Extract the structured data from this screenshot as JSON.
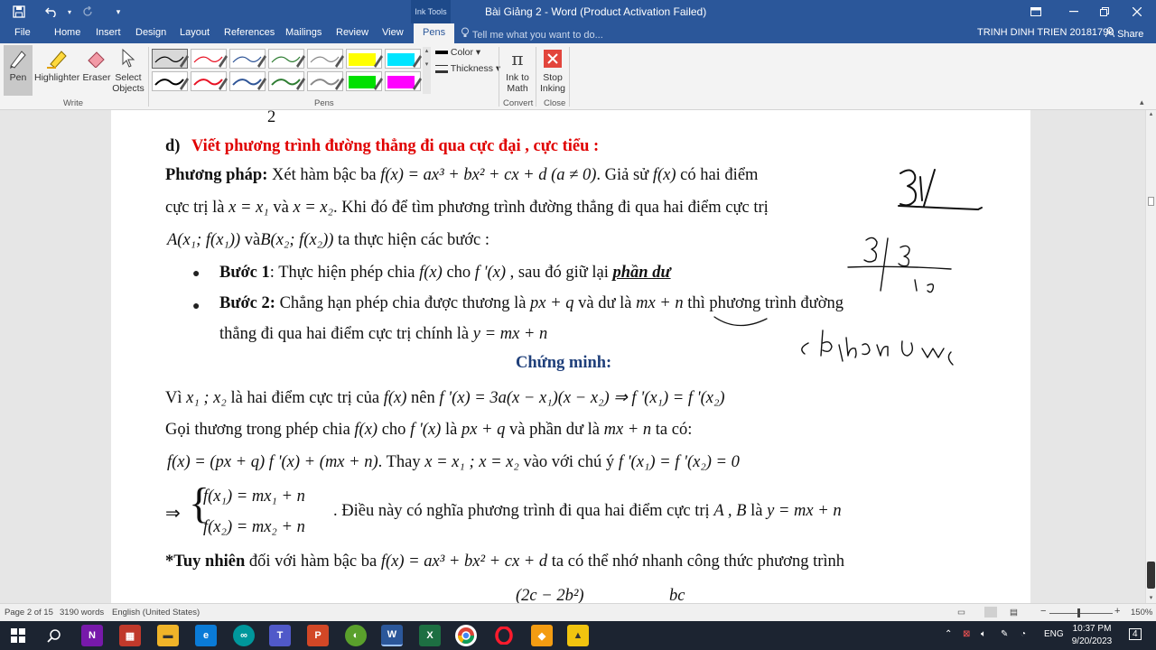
{
  "titlebar": {
    "title": "Bài Giảng 2 - Word (Product Activation Failed)",
    "ink_tools": "Ink Tools",
    "icons": [
      "save-icon",
      "undo-icon",
      "redo-icon",
      "customize-icon",
      "ribbon-display-icon",
      "minimize-icon",
      "restore-icon",
      "close-icon"
    ]
  },
  "tabs": [
    "File",
    "Home",
    "Insert",
    "Design",
    "Layout",
    "References",
    "Mailings",
    "Review",
    "View",
    "Pens"
  ],
  "active_tab": "Pens",
  "tell_me": "Tell me what you want to do...",
  "user": "TRINH DINH TRIEN 20181790",
  "share": "Share",
  "ribbon": {
    "write": {
      "pen": "Pen",
      "highlighter": "Highlighter",
      "eraser": "Eraser",
      "select_objects_1": "Select",
      "select_objects_2": "Objects",
      "label": "Write"
    },
    "pens_label": "Pens",
    "pen_colors": [
      "#000000",
      "#e81123",
      "#2f5597",
      "#2e7d32",
      "#888888",
      "#ffff00",
      "#00e5ff",
      "#000000",
      "#e81123",
      "#2f5597",
      "#2e7d32",
      "#888888",
      "#00e000",
      "#ff00ff"
    ],
    "color": "Color",
    "thickness": "Thickness",
    "convert": {
      "ink_to_math_1": "Ink to",
      "ink_to_math_2": "Math",
      "label": "Convert"
    },
    "close": {
      "stop_inking_1": "Stop",
      "stop_inking_2": "Inking",
      "label": "Close"
    }
  },
  "document": {
    "top_fragment": "2",
    "heading_d": "d)",
    "heading": "Viết phương trình đường thẳng đi qua cực đại , cực tiểu :",
    "method_label": "Phương pháp:",
    "method_text": "Xét hàm bậc ba",
    "formula_cubic": "f(x) = ax³ + bx² + cx + d (a ≠ 0)",
    "gia_su": ". Giả sử",
    "fx": "f(x)",
    "co_hai_diem": "có hai điểm",
    "line2_a": "cực trị là",
    "x_eq_x1": "x = x₁",
    "va": "và",
    "x_eq_x2": "x = x₂",
    "line2_b": ". Khi đó để tìm phương trình đường thẳng đi qua hai điểm cực trị",
    "point_a": "A(x₁; f(x₁))",
    "va_point": "và",
    "point_b": "B(x₂; f(x₂))",
    "line3_b": "ta thực hiện các bước :",
    "step1_label": "Bước 1",
    "step1_text": ": Thực hiện phép chia",
    "step1_fx": "f(x)",
    "step1_cho": "cho",
    "step1_fpx": "f '(x)",
    "step1_rest": ", sau đó giữ lại",
    "step1_phan_du": "phần dư",
    "step2_label": "Bước 2:",
    "step2_text": "Chẳng hạn phép chia được thương là",
    "step2_pq": "px + q",
    "step2_va_du": "và dư là",
    "step2_mn": "mx + n",
    "step2_rest": "thì phương trình đường",
    "step2_line2": "thẳng đi qua hai điểm cực trị chính là",
    "step2_eq": "y = mx + n",
    "proof_title": "Chứng minh:",
    "vi": "Vì",
    "vi_x1x2": "x₁ ; x₂",
    "vi_text": "là hai điểm cực trị của",
    "vi_fx": "f(x)",
    "vi_nen": "nên",
    "vi_formula": "f '(x) = 3a(x − x₁)(x − x₂) ⇒ f '(x₁) = f '(x₂)",
    "goi_text": "Gọi thương trong phép chia",
    "goi_fx": "f(x)",
    "goi_cho": "cho",
    "goi_fpx": "f '(x)",
    "goi_la": "là",
    "goi_pq": "px + q",
    "goi_va": "và phần dư là",
    "goi_mn": "mx + n",
    "goi_taco": "ta có:",
    "eq_main": "f(x) = (px + q) f '(x) + (mx + n)",
    "thay": ". Thay",
    "thay_x": "x = x₁ ; x = x₂",
    "thay_rest": "vào với chú ý",
    "thay_eq": "f '(x₁) = f '(x₂) = 0",
    "arrow": "⇒",
    "sys1": "f(x₁) = mx₁ + n",
    "sys2": "f(x₂) = mx₂ + n",
    "dieu_nay": ". Điều này có nghĩa phương trình đi qua hai điểm cực trị",
    "ab": "A , B",
    "la": "là",
    "line_eq": "y = mx + n",
    "tuy_nhien_label": "*Tuy nhiên",
    "tuy_nhien_text": "đối với hàm bậc ba",
    "tuy_nhien_formula": "f(x) = ax³ + bx² + cx + d",
    "tuy_nhien_rest": "ta có thể nhớ nhanh công thức phương trình",
    "bottom_fragment_1": "(2c − 2b²)",
    "bottom_fragment_2": "bc"
  },
  "status": {
    "page": "Page 2 of 15",
    "words": "3190 words",
    "language": "English (United States)",
    "zoom": "150%"
  },
  "taskbar": {
    "apps": [
      "windows-start",
      "search",
      "onenote",
      "app-grid",
      "file-explorer",
      "edge",
      "arduino",
      "teams",
      "powerpoint",
      "app-green",
      "word",
      "excel",
      "chrome",
      "opera",
      "app-orange",
      "app-yellow"
    ],
    "lang": "ENG",
    "time": "10:37 PM",
    "date": "9/20/2023",
    "notification_count": "4"
  }
}
